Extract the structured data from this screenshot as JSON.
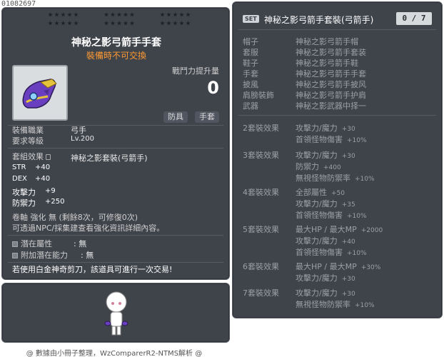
{
  "item_id": "01082697",
  "item": {
    "name": "神秘之影弓箭手手套",
    "tradeability": "裝備時不可交換",
    "combat_power_label": "戰鬥力提升量",
    "combat_power_value": "0",
    "tag_type": "防具",
    "tag_subtype": "手套",
    "job_label": "裝備職業",
    "job_value": "弓手",
    "level_label": "要求等級",
    "level_value": "Lv.200",
    "set_label": "套組效果",
    "set_name": "神秘之影套裝(弓箭手)",
    "stats": [
      {
        "key": "STR",
        "value": "+40"
      },
      {
        "key": "DEX",
        "value": "+40"
      },
      {
        "key": "攻擊力",
        "value": "+9"
      },
      {
        "key": "防禦力",
        "value": "+250"
      }
    ],
    "scroll_line": "卷軸 強化 無 (剩餘8次，可修復0次)",
    "enhance_line": "可透過NPC/採集建查看強化資訊詳細內容。",
    "potential_label": "潛在屬性",
    "potential_value": "無",
    "additional_potential_label": "附加潛在能力",
    "additional_potential_value": "無",
    "note": "若使用白金神奇剪刀，該道具可進行一次交易!",
    "icon": "archer-glove-icon"
  },
  "credits": "@ 數據由小冊子整理，WzComparerR2-NTMS解析 @",
  "set": {
    "badge": "SET",
    "title": "神秘之影弓箭手套裝(弓箭手)",
    "count": "0 / 7",
    "pieces": [
      {
        "slot": "帽子",
        "name": "神秘之影弓箭手帽"
      },
      {
        "slot": "套服",
        "name": "神秘之影弓箭手套装"
      },
      {
        "slot": "鞋子",
        "name": "神秘之影弓箭手鞋"
      },
      {
        "slot": "手套",
        "name": "神秘之影弓箭手手套"
      },
      {
        "slot": "披風",
        "name": "神秘之影弓箭手披风"
      },
      {
        "slot": "肩膀裝飾",
        "name": "神秘之影弓箭手护肩"
      },
      {
        "slot": "武器",
        "name": "神秘之影武器中择一"
      }
    ],
    "effects": [
      {
        "head": "2套裝效果",
        "lines": [
          {
            "text": "攻擊力/魔力",
            "num": "+30"
          },
          {
            "text": "首領怪物傷害",
            "num": "+10%"
          }
        ]
      },
      {
        "head": "3套裝效果",
        "lines": [
          {
            "text": "攻擊力/魔力",
            "num": "+30"
          },
          {
            "text": "防禦力",
            "num": "+400"
          },
          {
            "text": "無視怪物防禦率",
            "num": "+10%"
          }
        ]
      },
      {
        "head": "4套裝效果",
        "lines": [
          {
            "text": "全部屬性",
            "num": "+50"
          },
          {
            "text": "攻擊力/魔力",
            "num": "+35"
          },
          {
            "text": "首領怪物傷害",
            "num": "+10%"
          }
        ]
      },
      {
        "head": "5套裝效果",
        "lines": [
          {
            "text": "最大HP / 最大MP",
            "num": "+2000"
          },
          {
            "text": "攻擊力/魔力",
            "num": "+40"
          },
          {
            "text": "首領怪物傷害",
            "num": "+10%"
          }
        ]
      },
      {
        "head": "6套裝效果",
        "lines": [
          {
            "text": "最大HP / 最大MP",
            "num": "+30%"
          },
          {
            "text": "攻擊力/魔力",
            "num": "+30"
          }
        ]
      },
      {
        "head": "7套裝效果",
        "lines": [
          {
            "text": "攻擊力/魔力",
            "num": "+30"
          },
          {
            "text": "無視怪物防禦率",
            "num": "+10%"
          }
        ]
      }
    ]
  }
}
